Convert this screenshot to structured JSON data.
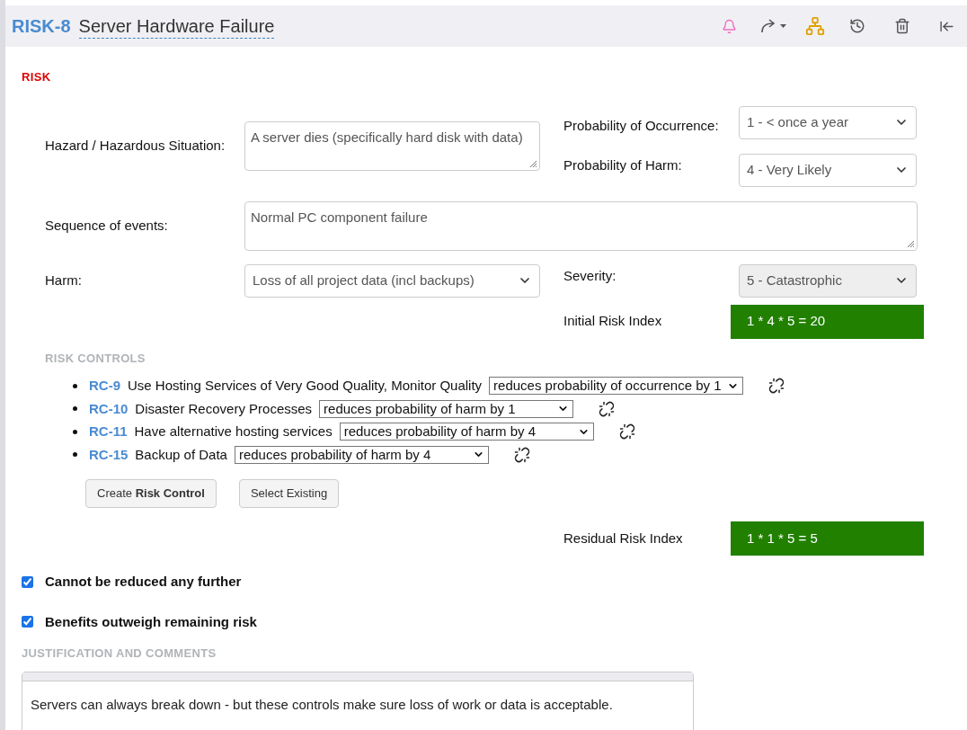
{
  "header": {
    "id": "RISK-8",
    "title": "Server Hardware Failure"
  },
  "section_title": "RISK",
  "hazard": {
    "label": "Hazard / Hazardous Situation:",
    "value": "A server dies (specifically hard disk with data)"
  },
  "probability_of_occurrence": {
    "label": "Probability of Occurrence:",
    "value": "1 - < once a year",
    "disabled": false
  },
  "probability_of_harm": {
    "label": "Probability of Harm:",
    "value": "4 - Very Likely",
    "disabled": false
  },
  "sequence": {
    "label": "Sequence of events:",
    "value": "Normal PC component failure"
  },
  "harm": {
    "label": "Harm:",
    "value": "Loss of all project data (incl backups)",
    "disabled": false
  },
  "severity": {
    "label": "Severity:",
    "value": "5 - Catastrophic",
    "disabled": true
  },
  "initial_risk": {
    "label": "Initial Risk Index",
    "value": "1 * 4 * 5 = 20",
    "color": "#218000"
  },
  "risk_controls": {
    "title": "RISK CONTROLS",
    "items": [
      {
        "id": "RC-9",
        "name": "Use Hosting Services of Very Good Quality, Monitor Quality",
        "effect": "reduces probability of occurrence by 1"
      },
      {
        "id": "RC-10",
        "name": "Disaster Recovery Processes",
        "effect": "reduces probability of harm by 1"
      },
      {
        "id": "RC-11",
        "name": "Have alternative hosting services",
        "effect": "reduces probability of harm by 4"
      },
      {
        "id": "RC-15",
        "name": "Backup of Data",
        "effect": "reduces probability of harm by 4"
      }
    ],
    "buttons": [
      "Create **Risk Control**",
      "Select Existing"
    ]
  },
  "residual_risk": {
    "label": "Residual Risk Index",
    "value": "1 * 1 * 5 = 5",
    "color": "#218000"
  },
  "checks": [
    {
      "label": "Cannot be reduced any further",
      "checked": true
    },
    {
      "label": "Benefits outweigh remaining risk",
      "checked": true
    }
  ],
  "justification": {
    "title": "JUSTIFICATION AND COMMENTS",
    "value": "Servers can always break down - but these controls make sure loss of work or data is acceptable."
  }
}
